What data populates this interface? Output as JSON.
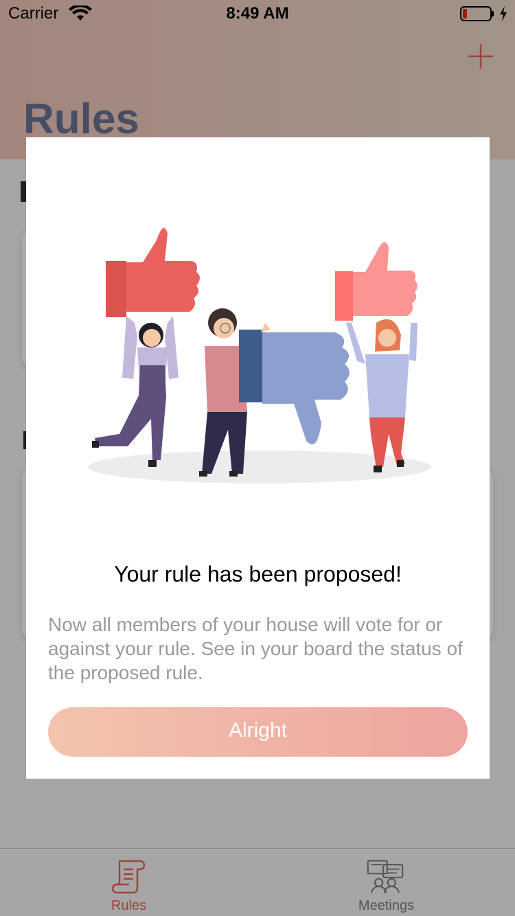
{
  "status_bar": {
    "carrier": "Carrier",
    "time": "8:49 AM",
    "wifi_icon": "wifi-icon",
    "battery_icon": "battery-low-icon",
    "charging_icon": "bolt-icon"
  },
  "header": {
    "title": "Rules",
    "add_icon": "plus-icon"
  },
  "modal": {
    "illustration": "people-holding-thumbs-illustration",
    "title": "Your rule has been proposed!",
    "body": "Now all members of your house will vote for or against your rule. See in your board the status of the proposed rule.",
    "button_label": "Alright"
  },
  "tabbar": {
    "tabs": [
      {
        "label": "Rules",
        "icon": "document-scroll-icon",
        "active": true
      },
      {
        "label": "Meetings",
        "icon": "meeting-people-icon",
        "active": false
      }
    ]
  },
  "colors": {
    "accent": "#e8675d",
    "button_gradient_start": "#f2c4ad",
    "button_gradient_end": "#eea49f",
    "title_text": "#6a7494"
  }
}
